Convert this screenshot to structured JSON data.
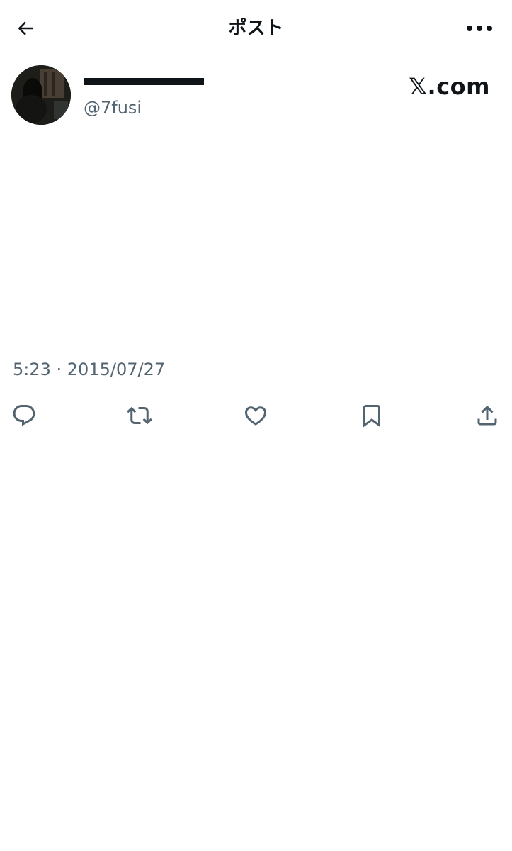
{
  "header": {
    "title": "ポスト",
    "back_icon": "arrow-left-icon",
    "more_icon": "more-horizontal-icon"
  },
  "author": {
    "display_name": "",
    "handle": "@7fusi",
    "site_logo": "𝕏.com"
  },
  "post": {
    "text": "",
    "timestamp": "5:23 · 2015/07/27"
  },
  "actions": {
    "icons": [
      "reply-icon",
      "repost-icon",
      "like-icon",
      "bookmark-icon",
      "share-icon"
    ]
  },
  "colors": {
    "text": "#0f1419",
    "secondary": "#536471",
    "background": "#ffffff"
  }
}
